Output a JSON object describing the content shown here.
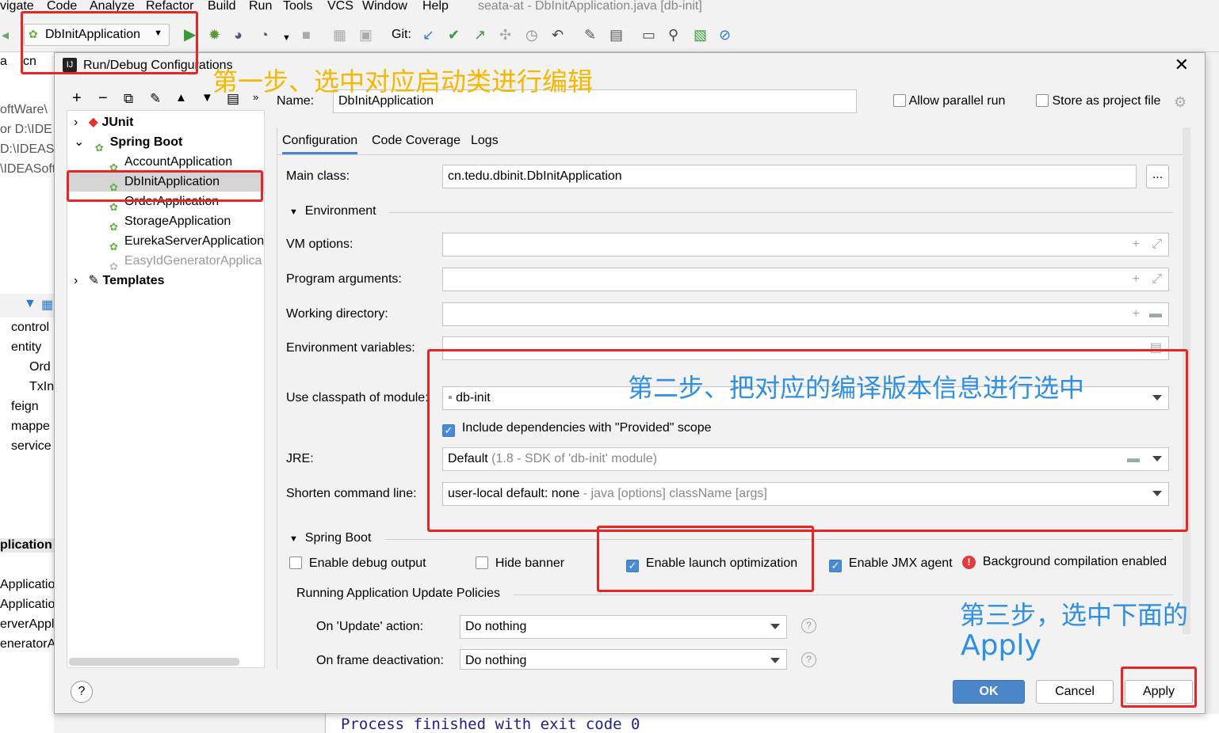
{
  "menubar": {
    "items": [
      "vigate",
      "Code",
      "Analyze",
      "Refactor",
      "Build",
      "Run",
      "Tools",
      "VCS",
      "Window",
      "Help"
    ],
    "window_title": "seata-at - DbInitApplication.java [db-init]"
  },
  "toolbar": {
    "run_config": "DbInitApplication",
    "git_label": "Git:"
  },
  "ide_left": {
    "breadcrumb": [
      "a",
      "cn"
    ],
    "lines": [
      "oftWare\\",
      "or D:\\IDE",
      "D:\\IDEASof",
      "\\IDEASoft"
    ],
    "project_items": [
      "control",
      "entity",
      "Ord",
      "TxIn",
      "feign",
      "mappe",
      "service"
    ],
    "run_items": [
      "plication",
      "Applicatio",
      "Applicatio",
      "erverAppl",
      "eneratorA"
    ]
  },
  "dialog": {
    "title": "Run/Debug Configurations",
    "name_label": "Name:",
    "name_value": "DbInitApplication",
    "allow_parallel": "Allow parallel run",
    "store_project": "Store as project file",
    "tree": {
      "junit": "JUnit",
      "spring_boot": "Spring Boot",
      "apps": [
        "AccountApplication",
        "DbInitApplication",
        "OrderApplication",
        "StorageApplication",
        "EurekaServerApplication",
        "EasyIdGeneratorApplica"
      ],
      "templates": "Templates"
    },
    "tabs": [
      "Configuration",
      "Code Coverage",
      "Logs"
    ],
    "main_class_label": "Main class:",
    "main_class_value": "cn.tedu.dbinit.DbInitApplication",
    "browse": "...",
    "environment": "Environment",
    "vm_options": "VM options:",
    "program_args": "Program arguments:",
    "working_dir": "Working directory:",
    "env_vars": "Environment variables:",
    "classpath_label": "Use classpath of module:",
    "classpath_value": "db-init",
    "include_deps": "Include dependencies with \"Provided\" scope",
    "jre_label": "JRE:",
    "jre_value": "Default",
    "jre_hint": "(1.8 - SDK of 'db-init' module)",
    "shorten_label": "Shorten command line:",
    "shorten_value": "user-local default: none",
    "shorten_hint": "- java [options] className [args]",
    "spring_boot_section": "Spring Boot",
    "enable_debug": "Enable debug output",
    "hide_banner": "Hide banner",
    "enable_launch": "Enable launch optimization",
    "enable_jmx": "Enable JMX agent",
    "bg_compile": "Background compilation enabled",
    "update_policies": "Running Application Update Policies",
    "on_update_label": "On 'Update' action:",
    "on_update_value": "Do nothing",
    "on_frame_label": "On frame deactivation:",
    "on_frame_value": "Do nothing",
    "help": "?",
    "ok": "OK",
    "cancel": "Cancel",
    "apply": "Apply"
  },
  "annotations": {
    "step1": "第一步、选中对应启动类进行编辑",
    "step2": "第二步、把对应的编译版本信息进行选中",
    "step3_line1": "第三步，选中下面的",
    "step3_line2": "Apply"
  },
  "console": {
    "text": "Process finished with exit code 0"
  },
  "colors": {
    "annotation_orange": "#f5b800",
    "annotation_blue": "#2f8fe0",
    "highlight_red": "#e82525",
    "primary_button": "#4a86c8",
    "checkbox_blue": "#4a8bd3"
  }
}
